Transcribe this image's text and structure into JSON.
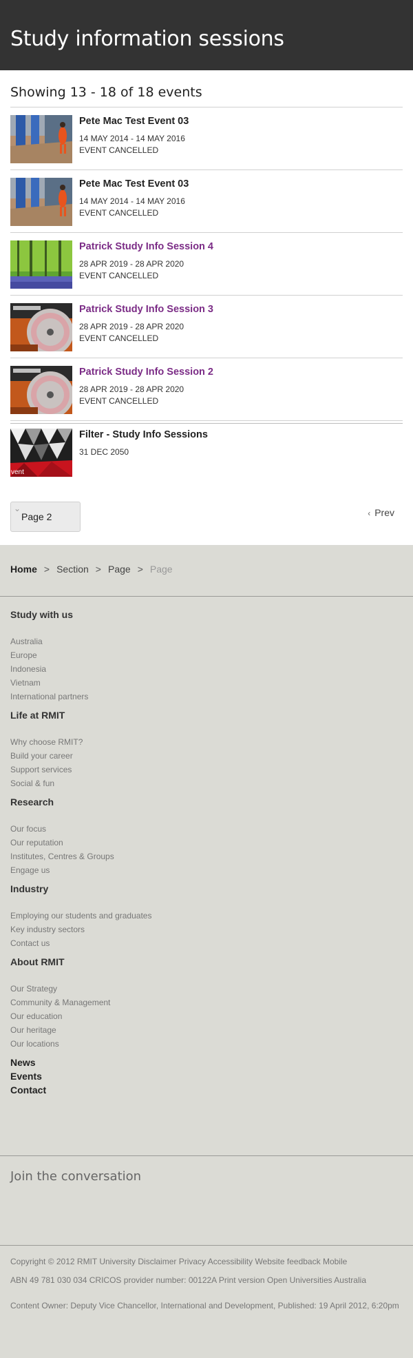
{
  "header": {
    "title": "Study information sessions"
  },
  "results": {
    "showing": "Showing 13 - 18 of 18 events"
  },
  "events": [
    {
      "title": "Pete Mac Test Event 03",
      "date": "14 MAY 2014 - 14 MAY 2016",
      "status": "EVENT CANCELLED",
      "image": "street-photo"
    },
    {
      "title": "Pete Mac Test Event 03",
      "date": "14 MAY 2014 - 14 MAY 2016",
      "status": "EVENT CANCELLED",
      "image": "street-photo"
    },
    {
      "title": "Patrick Study Info Session 4",
      "date": "28 APR 2019 - 28 APR 2020",
      "status": "EVENT CANCELLED",
      "image": "forest-photo"
    },
    {
      "title": "Patrick Study Info Session 3",
      "date": "28 APR 2019 - 28 APR 2020",
      "status": "EVENT CANCELLED",
      "image": "turntable-photo"
    },
    {
      "title": "Patrick Study Info Session 2",
      "date": "28 APR 2019 - 28 APR 2020",
      "status": "EVENT CANCELLED",
      "image": "turntable-photo"
    },
    {
      "title": "Filter - Study Info Sessions",
      "date": "31 DEC 2050",
      "status": "",
      "image": "geometric-event-graphic",
      "image_caption": "vent"
    }
  ],
  "pagination": {
    "current": "Page 2",
    "prev_label": "Prev"
  },
  "breadcrumb": [
    "Home",
    "Section",
    "Page",
    "Page"
  ],
  "footer": {
    "sections": [
      {
        "title": "Study with us",
        "links": [
          "Australia",
          "Europe",
          "Indonesia",
          "Vietnam",
          "International partners"
        ]
      },
      {
        "title": "Life at RMIT",
        "links": [
          "Why choose RMIT?",
          "Build your career",
          "Support services",
          "Social & fun"
        ]
      },
      {
        "title": "Research",
        "links": [
          "Our focus",
          "Our reputation",
          "Institutes, Centres & Groups",
          "Engage us"
        ]
      },
      {
        "title": "Industry",
        "links": [
          "Employing our students and graduates",
          "Key industry sectors",
          "Contact us"
        ]
      },
      {
        "title": "About RMIT",
        "links": [
          "Our Strategy",
          "Community & Management",
          "Our education",
          "Our heritage",
          "Our locations"
        ]
      }
    ],
    "quick_links": [
      "News",
      "Events",
      "Contact"
    ],
    "join_title": "Join the conversation",
    "legal_line1": [
      "Copyright © 2012 RMIT University",
      "Disclaimer",
      "Privacy",
      "Accessibility",
      "Website feedback",
      "Mobile"
    ],
    "legal_line2": [
      "ABN 49 781 030 034",
      "CRICOS provider number: 00122A",
      "Print version",
      "Open Universities Australia"
    ],
    "content_owner": "Content Owner: Deputy Vice Chancellor, International and Development, Published: 19 April 2012, 6:20pm"
  },
  "colors": {
    "header_bg": "#333333",
    "accent_purple": "#7b2c86",
    "footer_bg": "#dbdbd5"
  }
}
